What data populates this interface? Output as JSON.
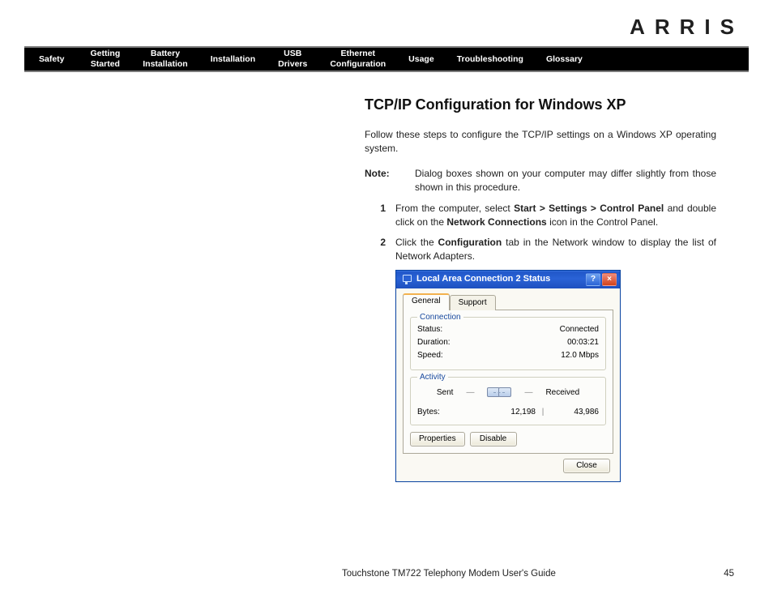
{
  "brand": "ARRIS",
  "nav": [
    "Safety",
    "Getting\nStarted",
    "Battery\nInstallation",
    "Installation",
    "USB\nDrivers",
    "Ethernet\nConfiguration",
    "Usage",
    "Troubleshooting",
    "Glossary"
  ],
  "page": {
    "heading": "TCP/IP Configuration for Windows XP",
    "intro": "Follow these steps to configure the TCP/IP settings on a Windows XP operating system.",
    "note_label": "Note:",
    "note_text": "Dialog boxes shown on your computer may differ slightly from those shown in this procedure.",
    "steps": [
      {
        "num": "1",
        "pre": "From the computer, select ",
        "bold1": "Start > Settings > Control Panel",
        "mid": " and double click on the ",
        "bold2": "Network Connections",
        "post": " icon in the Control Panel."
      },
      {
        "num": "2",
        "pre": "Click the ",
        "bold1": "Configuration",
        "mid": " tab in the Network window to display the list of Network Adapters.",
        "bold2": "",
        "post": ""
      }
    ]
  },
  "dialog": {
    "title": "Local Area Connection 2 Status",
    "help": "?",
    "close": "×",
    "tabs": {
      "general": "General",
      "support": "Support"
    },
    "connection": {
      "legend": "Connection",
      "status_k": "Status:",
      "status_v": "Connected",
      "duration_k": "Duration:",
      "duration_v": "00:03:21",
      "speed_k": "Speed:",
      "speed_v": "12.0 Mbps"
    },
    "activity": {
      "legend": "Activity",
      "sent": "Sent",
      "received": "Received",
      "bytes_k": "Bytes:",
      "bytes_sent": "12,198",
      "bytes_recv": "43,986",
      "sep": "|"
    },
    "buttons": {
      "properties": "Properties",
      "disable": "Disable",
      "close": "Close"
    }
  },
  "footer": {
    "title": "Touchstone TM722 Telephony Modem User's Guide",
    "page": "45"
  }
}
